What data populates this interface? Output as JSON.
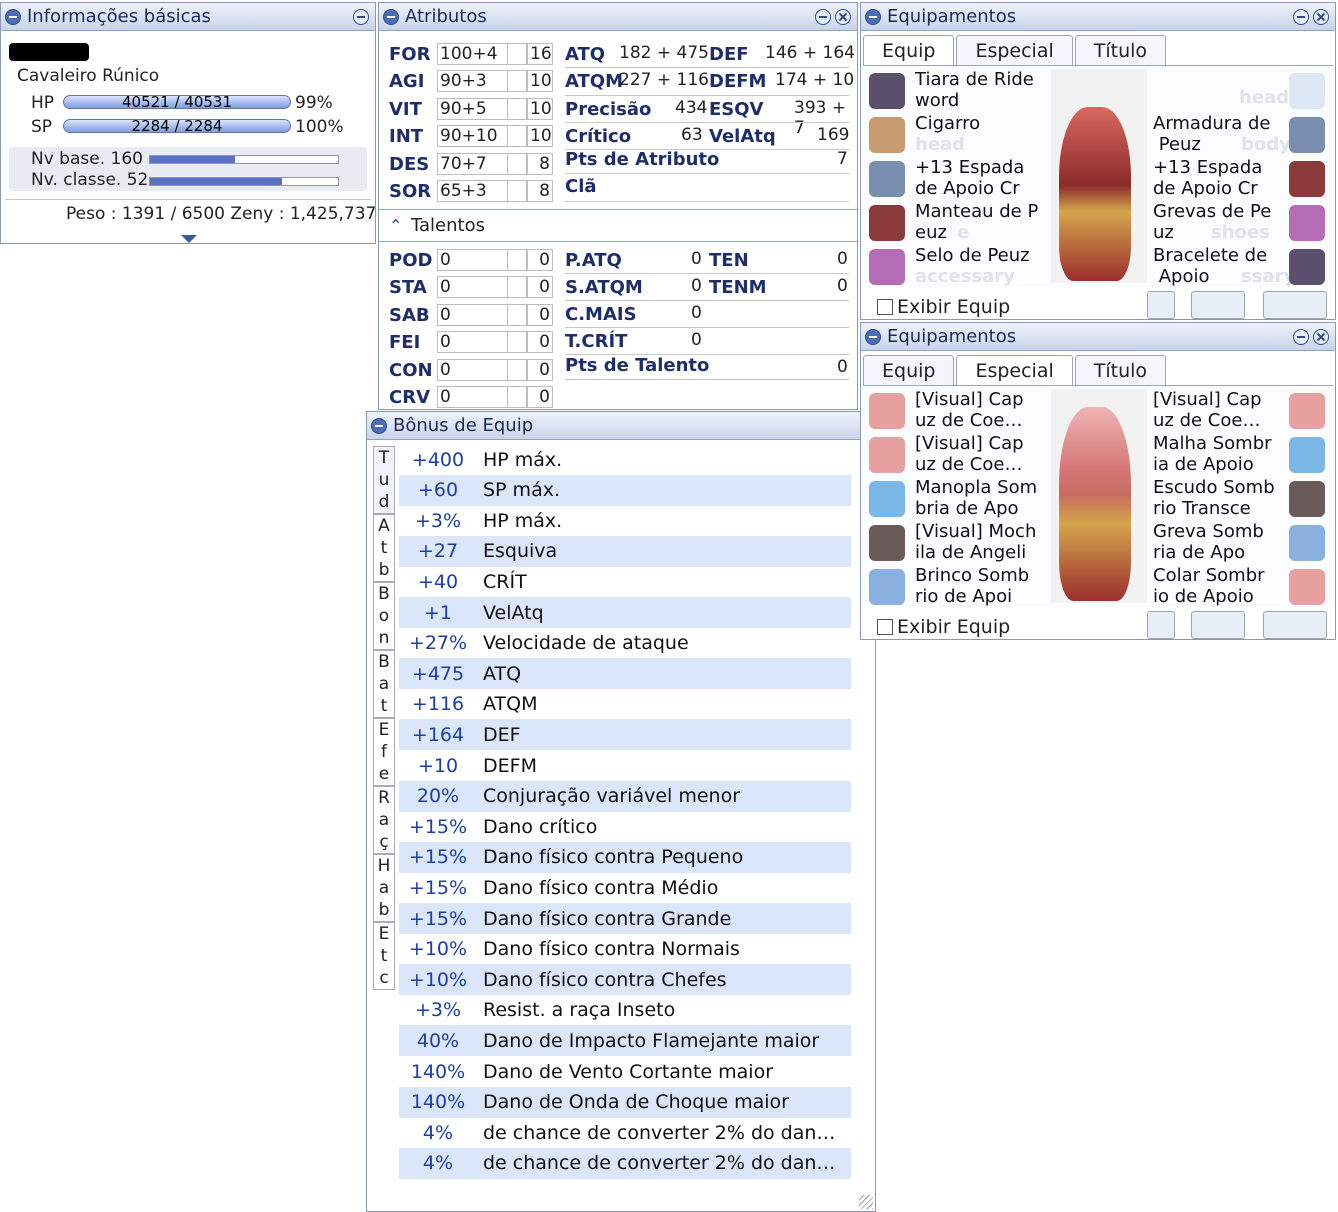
{
  "basic_info": {
    "title": "Informações básicas",
    "job": "Cavaleiro Rúnico",
    "hp_label": "HP",
    "hp_value": "40521  /  40531",
    "hp_pct": "99%",
    "hp_fill": 0.99,
    "sp_label": "SP",
    "sp_value": "2284  /  2284",
    "sp_pct": "100%",
    "sp_fill": 1.0,
    "base_level": "Nv base. 160",
    "base_exp_fill": 0.45,
    "job_level": "Nv. classe. 52",
    "job_exp_fill": 0.7,
    "weight_zeny": "Peso : 1391 / 6500   Zeny : 1,425,737"
  },
  "attributes": {
    "title": "Atributos",
    "stats": [
      {
        "name": "FOR",
        "value": "100+4",
        "cost": "16"
      },
      {
        "name": "AGI",
        "value": "90+3",
        "cost": "10"
      },
      {
        "name": "VIT",
        "value": "90+5",
        "cost": "10"
      },
      {
        "name": "INT",
        "value": "90+10",
        "cost": "10"
      },
      {
        "name": "DES",
        "value": "70+7",
        "cost": "8"
      },
      {
        "name": "SOR",
        "value": "65+3",
        "cost": "8"
      }
    ],
    "atk_label": "ATQ",
    "atk": "182 + 475",
    "def_label": "DEF",
    "def": "146 + 164",
    "matk_label": "ATQM",
    "matk": "227 + 116",
    "mdef_label": "DEFM",
    "mdef": "174 + 10",
    "hit_label": "Precisão",
    "hit": "434",
    "flee_label": "ESQV",
    "flee": "393 + 7",
    "crit_label": "Crítico",
    "crit": "63",
    "aspd_label": "VelAtq",
    "aspd": "169",
    "points_label": "Pts de Atributo",
    "points": "7",
    "guild_label": "Clã",
    "talents_title": "Talentos",
    "traits": [
      {
        "name": "POD",
        "value": "0",
        "cost": "0"
      },
      {
        "name": "STA",
        "value": "0",
        "cost": "0"
      },
      {
        "name": "SAB",
        "value": "0",
        "cost": "0"
      },
      {
        "name": "FEI",
        "value": "0",
        "cost": "0"
      },
      {
        "name": "CON",
        "value": "0",
        "cost": "0"
      },
      {
        "name": "CRV",
        "value": "0",
        "cost": "0"
      }
    ],
    "patk_label": "P.ATQ",
    "patk": "0",
    "res_label": "TEN",
    "res": "0",
    "smatk_label": "S.ATQM",
    "smatk": "0",
    "mres_label": "TENM",
    "mres": "0",
    "hplus_label": "C.MAIS",
    "hplus": "0",
    "crate_label": "T.CRÍT",
    "crate": "0",
    "tpoints_label": "Pts de Talento",
    "tpoints": "0"
  },
  "equip_bonus": {
    "title": "Bônus de Equip",
    "side_tabs": [
      "T\nu\nd",
      "A\nt\nb",
      "B\no\nn",
      "B\na\nt",
      "E\nf\ne",
      "R\na\nç",
      "H\na\nb",
      "E\nt\nc"
    ],
    "rows": [
      {
        "v": "+400",
        "t": "HP máx."
      },
      {
        "v": "+60",
        "t": "SP máx."
      },
      {
        "v": "+3%",
        "t": "HP máx."
      },
      {
        "v": "+27",
        "t": "Esquiva"
      },
      {
        "v": "+40",
        "t": "CRÍT"
      },
      {
        "v": "+1",
        "t": "VelAtq"
      },
      {
        "v": "+27%",
        "t": "Velocidade de ataque"
      },
      {
        "v": "+475",
        "t": "ATQ"
      },
      {
        "v": "+116",
        "t": "ATQM"
      },
      {
        "v": "+164",
        "t": "DEF"
      },
      {
        "v": "+10",
        "t": "DEFM"
      },
      {
        "v": "20%",
        "t": "Conjuração variável menor"
      },
      {
        "v": "+15%",
        "t": "Dano crítico"
      },
      {
        "v": "+15%",
        "t": "Dano físico contra Pequeno"
      },
      {
        "v": "+15%",
        "t": "Dano físico contra Médio"
      },
      {
        "v": "+15%",
        "t": "Dano físico contra Grande"
      },
      {
        "v": "+10%",
        "t": "Dano físico contra Normais"
      },
      {
        "v": "+10%",
        "t": "Dano físico contra Chefes"
      },
      {
        "v": "+3%",
        "t": "Resist. a raça Inseto"
      },
      {
        "v": "40%",
        "t": "Dano de Impacto Flamejante maior"
      },
      {
        "v": "140%",
        "t": "Dano de Vento Cortante maior"
      },
      {
        "v": "140%",
        "t": "Dano de Onda de Choque maior"
      },
      {
        "v": "4%",
        "t": "de chance de converter 2% do dan…"
      },
      {
        "v": "4%",
        "t": "de chance de converter 2% do dan…"
      }
    ]
  },
  "equip1": {
    "title": "Equipamentos",
    "tabs": [
      "Equip",
      "Especial",
      "Título"
    ],
    "left": [
      "Tiara de Ride\nword",
      "Cigarro",
      "+13 Espada\nde Apoio Cr",
      "Manteau de P\neuz",
      "Selo de Peuz"
    ],
    "right": [
      "",
      "Armadura de\n Peuz",
      "+13 Espada\nde Apoio Cr",
      "Grevas de Pe\nuz",
      "Bracelete de\n Apoio"
    ],
    "ghost_left": [
      "",
      "head",
      "",
      "e",
      "accessary"
    ],
    "ghost_right": [
      "head",
      "body",
      "",
      "shoes",
      "ssary"
    ],
    "show_equip": "Exibir Equip"
  },
  "equip2": {
    "title": "Equipamentos",
    "tabs": [
      "Equip",
      "Especial",
      "Título"
    ],
    "left": [
      "[Visual] Cap\nuz de Coe…",
      "[Visual] Cap\nuz de Coe…",
      "Manopla Som\nbria de Apo",
      "[Visual] Moch\nila de Angeli",
      "Brinco Somb\nrio de Apoi"
    ],
    "right": [
      "[Visual] Cap\nuz de Coe…",
      "Malha Sombr\nia de Apoio",
      "Escudo Somb\nrio Transce",
      "Greva Somb\nria de Apo",
      "Colar Sombr\nio de Apoio"
    ],
    "show_equip": "Exibir Equip"
  }
}
